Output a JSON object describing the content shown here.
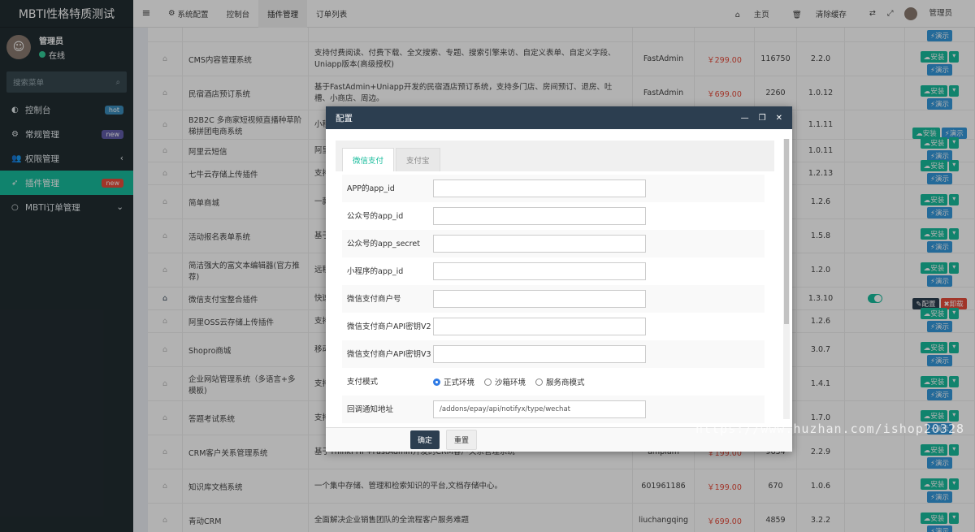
{
  "app": {
    "title": "MBTI性格特质测试"
  },
  "user": {
    "name": "管理员",
    "status": "在线",
    "avatar_icon": "avatar"
  },
  "sidebar": {
    "search_placeholder": "搜索菜单",
    "items": [
      {
        "label": "控制台",
        "badge": "hot",
        "icon": "dashboard-icon"
      },
      {
        "label": "常规管理",
        "badge": "new",
        "icon": "cogs-icon"
      },
      {
        "label": "权限管理",
        "badge": "‹",
        "icon": "users-icon"
      },
      {
        "label": "插件管理",
        "badge": "new",
        "icon": "rocket-icon"
      },
      {
        "label": "MBTI订单管理",
        "badge": "⌄",
        "icon": "circle-icon"
      }
    ]
  },
  "topbar": {
    "tabs": [
      "系统配置",
      "控制台",
      "插件管理",
      "订单列表"
    ],
    "home": "主页",
    "clear": "清除缓存",
    "admin": "管理员"
  },
  "table": {
    "rows": [
      {
        "name": "",
        "desc": "",
        "author": "",
        "price": "",
        "downloads": "",
        "version": "",
        "btns": "demo"
      },
      {
        "name": "CMS内容管理系统",
        "desc": "支持付费阅读、付费下载、全文搜索、专题、搜索引擎来访、自定义表单、自定义字段、Uniapp版本(高级授权)",
        "author": "FastAdmin",
        "price": "￥299.00",
        "downloads": "116750",
        "version": "2.2.0",
        "btns": "install"
      },
      {
        "name": "民宿酒店预订系统",
        "desc": "基于FastAdmin+Uniapp开发的民宿酒店预订系统，支持多门店、房间预订、退房、吐槽、小商店、周边。",
        "author": "FastAdmin",
        "price": "￥699.00",
        "downloads": "2260",
        "version": "1.0.12",
        "btns": "install"
      },
      {
        "name": "B2B2C 多商家短视频直播种草阶梯拼团电商系统",
        "desc": "小程序商城",
        "author": "",
        "price": "",
        "downloads": "",
        "version": "1.1.11",
        "btns": "install2"
      },
      {
        "name": "阿里云短信",
        "desc": "阿里",
        "author": "",
        "price": "",
        "downloads": "",
        "version": "1.0.11",
        "btns": "install"
      },
      {
        "name": "七牛云存储上传插件",
        "desc": "支持",
        "author": "",
        "price": "",
        "downloads": "",
        "version": "1.2.13",
        "btns": "install"
      },
      {
        "name": "简单商城",
        "desc": "一款换、",
        "author": "",
        "price": "",
        "downloads": "",
        "version": "1.2.6",
        "btns": "install"
      },
      {
        "name": "活动报名表单系统",
        "desc": "基于名、",
        "author": "",
        "price": "",
        "downloads": "",
        "version": "1.5.8",
        "btns": "install"
      },
      {
        "name": "简洁强大的富文本编辑器(官方推荐)",
        "desc": "远程",
        "author": "",
        "price": "",
        "downloads": "",
        "version": "1.2.0",
        "btns": "install"
      },
      {
        "name": "微信支付宝整合插件",
        "desc": "快速",
        "author": "",
        "price": "",
        "downloads": "",
        "version": "1.3.10",
        "btns": "config"
      },
      {
        "name": "阿里OSS云存储上传插件",
        "desc": "支持",
        "author": "",
        "price": "",
        "downloads": "",
        "version": "1.2.6",
        "btns": "install"
      },
      {
        "name": "Shopro商城",
        "desc": "移动",
        "author": "",
        "price": "",
        "downloads": "",
        "version": "3.0.7",
        "btns": "install"
      },
      {
        "name": "企业网站管理系统（多语言+多模板)",
        "desc": "支持",
        "author": "",
        "price": "",
        "downloads": "",
        "version": "1.4.1",
        "btns": "install"
      },
      {
        "name": "答题考试系统",
        "desc": "支持",
        "author": "",
        "price": "",
        "downloads": "",
        "version": "1.7.0",
        "btns": "install"
      },
      {
        "name": "CRM客户关系管理系统",
        "desc": "基于ThinkPHP+FastAdmin开发的CRM客户关系管理系统",
        "author": "ampiam",
        "price": "￥199.00",
        "downloads": "9634",
        "version": "2.2.9",
        "btns": "install"
      },
      {
        "name": "知识库文档系统",
        "desc": "一个集中存储、管理和检索知识的平台,文档存储中心。",
        "author": "601961186",
        "price": "￥199.00",
        "downloads": "670",
        "version": "1.0.6",
        "btns": "install"
      },
      {
        "name": "青动CRM",
        "desc": "全面解决企业销售团队的全流程客户服务难题",
        "author": "liuchangqing",
        "price": "￥699.00",
        "downloads": "4859",
        "version": "3.2.2",
        "btns": "install"
      }
    ],
    "install": "安装",
    "demo": "演示",
    "config": "配置",
    "uninstall": "卸载"
  },
  "modal": {
    "title": "配置",
    "tabs": [
      "微信支付",
      "支付宝"
    ],
    "fields": [
      {
        "label": "APP的app_id",
        "value": ""
      },
      {
        "label": "公众号的app_id",
        "value": ""
      },
      {
        "label": "公众号的app_secret",
        "value": ""
      },
      {
        "label": "小程序的app_id",
        "value": ""
      },
      {
        "label": "微信支付商户号",
        "value": ""
      },
      {
        "label": "微信支付商户API密钥V2",
        "value": ""
      },
      {
        "label": "微信支付商户API密钥V3",
        "value": ""
      }
    ],
    "mode_label": "支付模式",
    "modes": [
      "正式环境",
      "沙箱环境",
      "服务商模式"
    ],
    "notify_label": "回调通知地址",
    "notify_value": "/addons/epay/api/notifyx/type/wechat",
    "ok": "确定",
    "reset": "重置"
  },
  "watermark": "https://www.huzhan.com/ishop20328"
}
